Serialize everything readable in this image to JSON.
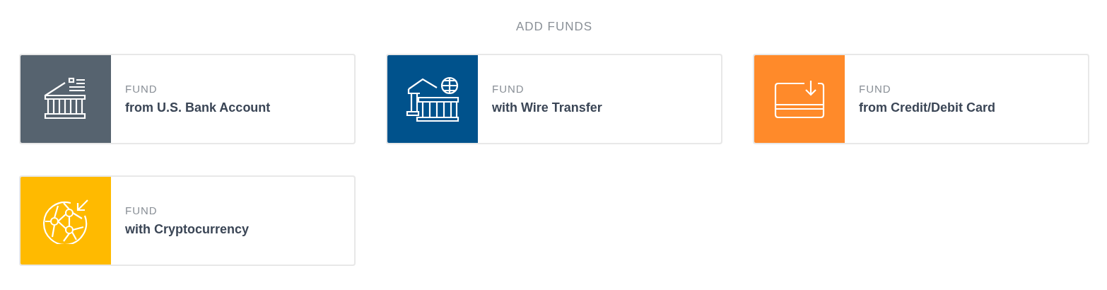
{
  "title": "ADD FUNDS",
  "options": [
    {
      "kind": "bank",
      "color": "#56636f",
      "label": "FUND",
      "text": "from U.S. Bank Account"
    },
    {
      "kind": "wire",
      "color": "#00528c",
      "label": "FUND",
      "text": "with Wire Transfer"
    },
    {
      "kind": "card",
      "color": "#ff8a2a",
      "label": "FUND",
      "text": "from Credit/Debit Card"
    },
    {
      "kind": "crypto",
      "color": "#ffba00",
      "label": "FUND",
      "text": "with Cryptocurrency"
    }
  ]
}
